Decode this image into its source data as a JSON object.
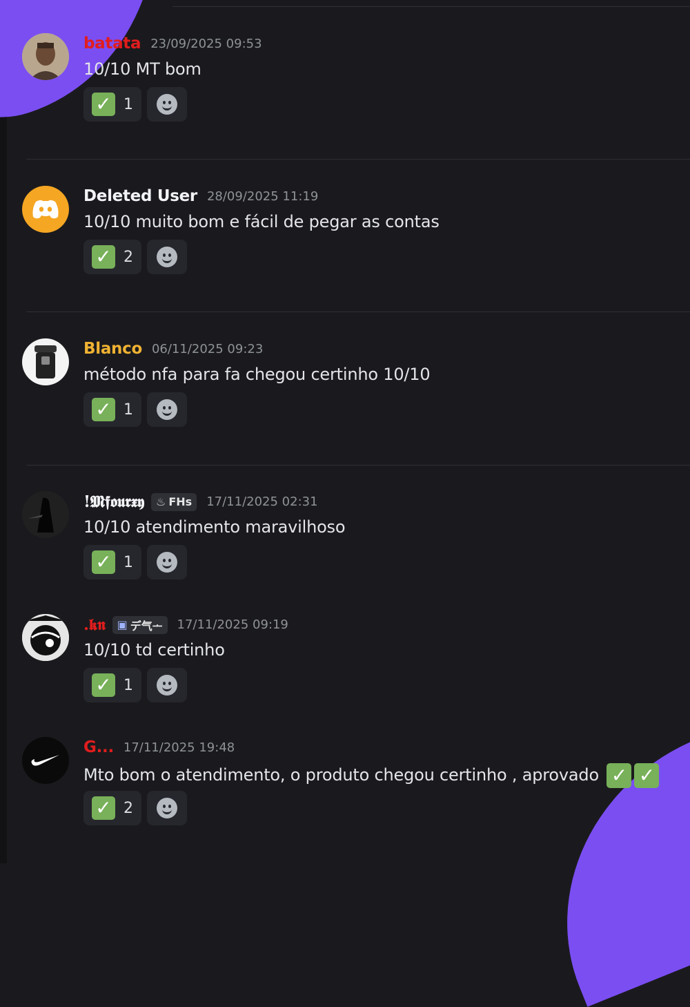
{
  "messages": [
    {
      "username": "batata",
      "color": "#e11d1d",
      "tag": "",
      "timestamp": "23/09/2025 09:53",
      "text": "10/10 MT bom",
      "reaction_count": "1",
      "avatar": "portrait-photo"
    },
    {
      "username": "Deleted User",
      "color": "#f2f3f5",
      "tag": "",
      "timestamp": "28/09/2025 11:19",
      "text": "10/10 muito bom e fácil de pegar as contas",
      "reaction_count": "2",
      "avatar": "discord-logo-icon"
    },
    {
      "username": "Blanco",
      "color": "#f0b232",
      "tag": "",
      "timestamp": "06/11/2025 09:23",
      "text": "método nfa para fa chegou certinho 10/10",
      "reaction_count": "1",
      "avatar": "trash-bin-icon"
    },
    {
      "username": "!𝕸𝖋𝖔𝖚𝖗𝖝𝖞",
      "color": "#f2f3f5",
      "tag": "FHs",
      "timestamp": "17/11/2025 02:31",
      "text": "10/10 atendimento maravilhoso",
      "reaction_count": "1",
      "avatar": "dark-figure-photo"
    },
    {
      "username": ".𝖐𝖓",
      "color": "#e11d1d",
      "tag": "デ气ᅩ",
      "timestamp": "17/11/2025 09:19",
      "text": "10/10 td certinho",
      "reaction_count": "1",
      "avatar": "anime-art-photo"
    },
    {
      "username": "G...",
      "color": "#e11d1d",
      "tag": "",
      "timestamp": "17/11/2025 19:48",
      "text": "Mto bom o atendimento, o produto chegou certinho , aprovado",
      "reaction_count": "2",
      "avatar": "nike-swoosh-icon"
    }
  ],
  "reaction_emoji": "✓",
  "accent_color": "#7b4ef2"
}
